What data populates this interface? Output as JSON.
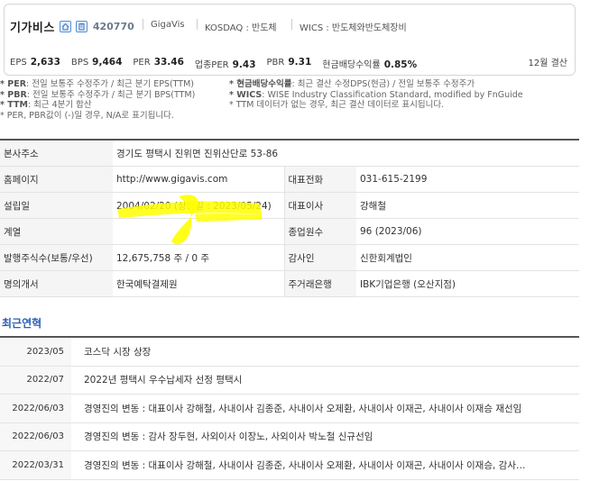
{
  "company": {
    "name": "기가비스",
    "code": "420770",
    "short_name": "GigaVis",
    "market": "KOSDAQ : 반도체",
    "wics": "WICS : 반도체와반도체장비"
  },
  "metrics": [
    {
      "label": "EPS",
      "value": "2,633"
    },
    {
      "label": "BPS",
      "value": "9,464"
    },
    {
      "label": "PER",
      "value": "33.46"
    },
    {
      "label": "업종PER",
      "value": "9.43"
    },
    {
      "label": "PBR",
      "value": "9.31"
    },
    {
      "label": "현금배당수익률",
      "value": "0.85%"
    }
  ],
  "fiscal_month": "12월 결산",
  "notes_left": [
    {
      "key": "* PER",
      "text": ": 전일 보통주 수정주가 / 최근 분기 EPS(TTM)"
    },
    {
      "key": "* PBR",
      "text": ": 전일 보통주 수정주가 / 최근 분기 BPS(TTM)"
    },
    {
      "key": "* TTM",
      "text": ": 최근 4분기 합산"
    },
    {
      "key": "",
      "text": "* PER, PBR값이 (-)일 경우, N/A로 표기됩니다."
    }
  ],
  "notes_right": [
    {
      "key": "* 현금배당수익률",
      "text": ": 최근 결산 수정DPS(현금) / 전일 보통주 수정주가"
    },
    {
      "key": "* WICS",
      "text": ": WISE Industry Classification Standard, modified by FnGuide"
    },
    {
      "key": "",
      "text": "* TTM 데이터가 없는 경우, 최근 결산 데이터로 표시됩니다."
    }
  ],
  "info": {
    "address_label": "본사주소",
    "address": "경기도 평택시 진위면 진위산단로 53-86",
    "homepage_label": "홈페이지",
    "homepage": "http://www.gigavis.com",
    "phone_label": "대표전화",
    "phone": "031-615-2199",
    "founded_label": "설립일",
    "founded": "2004/02/20 (상장일 : 2023/05/24)",
    "ceo_label": "대표이사",
    "ceo": "강해철",
    "group_label": "계열",
    "group": "",
    "employees_label": "종업원수",
    "employees": "96 (2023/06)",
    "shares_label": "발행주식수(보통/우선)",
    "shares": "12,675,758 주 / 0 주",
    "auditor_label": "감사인",
    "auditor": "신한회계법인",
    "registrar_label": "명의개서",
    "registrar": "한국예탁결제원",
    "bank_label": "주거래은행",
    "bank": "IBK기업은행 (오산지점)"
  },
  "history_title": "최근연혁",
  "history": [
    {
      "date": "2023/05",
      "event": "코스닥 시장 상장"
    },
    {
      "date": "2022/07",
      "event": "2022년 평택시 우수납세자 선정 평택시"
    },
    {
      "date": "2022/06/03",
      "event": "경영진의 변동 : 대표이사 강해철, 사내이사 김종준, 사내이사 오제환, 사내이사 이재곤, 사내이사 이재승 재선임"
    },
    {
      "date": "2022/06/03",
      "event": "경영진의 변동 : 감사 장두현, 사외이사 이장노, 사외이사 박노철 신규선임"
    },
    {
      "date": "2022/03/31",
      "event": "경영진의 변동 : 대표이사 강해철, 사내이사 김종준, 사내이사 오제환, 사내이사 이재곤, 사내이사 이재승, 감사…"
    }
  ],
  "colors": {
    "accent": "#2b5fb3",
    "highlight": "#ffff00"
  }
}
